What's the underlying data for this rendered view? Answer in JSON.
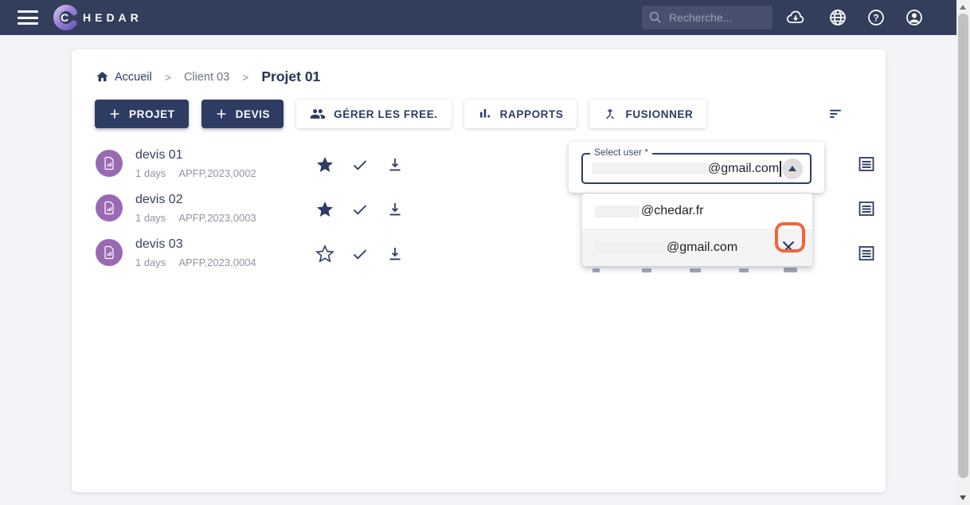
{
  "topbar": {
    "brand": {
      "first": "C",
      "rest": "HEDAR"
    },
    "search_placeholder": "Recherche...",
    "icons": [
      "cloud-download",
      "globe",
      "help",
      "account"
    ]
  },
  "breadcrumb": {
    "home_label": "Accueil",
    "separator": ">",
    "client_label": "Client 03",
    "project_label": "Projet 01"
  },
  "toolbar": {
    "projet_label": "PROJET",
    "devis_label": "DEVIS",
    "gerer_label": "GÉRER LES FREE.",
    "rapports_label": "RAPPORTS",
    "fusionner_label": "FUSIONNER"
  },
  "devis": {
    "rows": [
      {
        "title": "devis 01",
        "age": "1 days",
        "ref": "APFP,2023,0002",
        "starred": true
      },
      {
        "title": "devis 02",
        "age": "1 days",
        "ref": "APFP,2023,0003",
        "starred": true
      },
      {
        "title": "devis 03",
        "age": "1 days",
        "ref": "APFP,2023,0004",
        "starred": false
      }
    ]
  },
  "select_user": {
    "label": "Select user *",
    "value_visible": "@gmail.com",
    "value_redacted": true,
    "options": [
      {
        "visible": "@chedar.fr",
        "redacted": true,
        "selected": false
      },
      {
        "visible": "@gmail.com",
        "redacted": true,
        "selected": true
      }
    ]
  },
  "colors": {
    "topbar_navy": "#333E5C",
    "button_navy": "#2E3C64",
    "avatar_purple": "#9A69B3",
    "annotation_orange": "#F2653C",
    "selected_option_bg": "#f4f4f4"
  }
}
